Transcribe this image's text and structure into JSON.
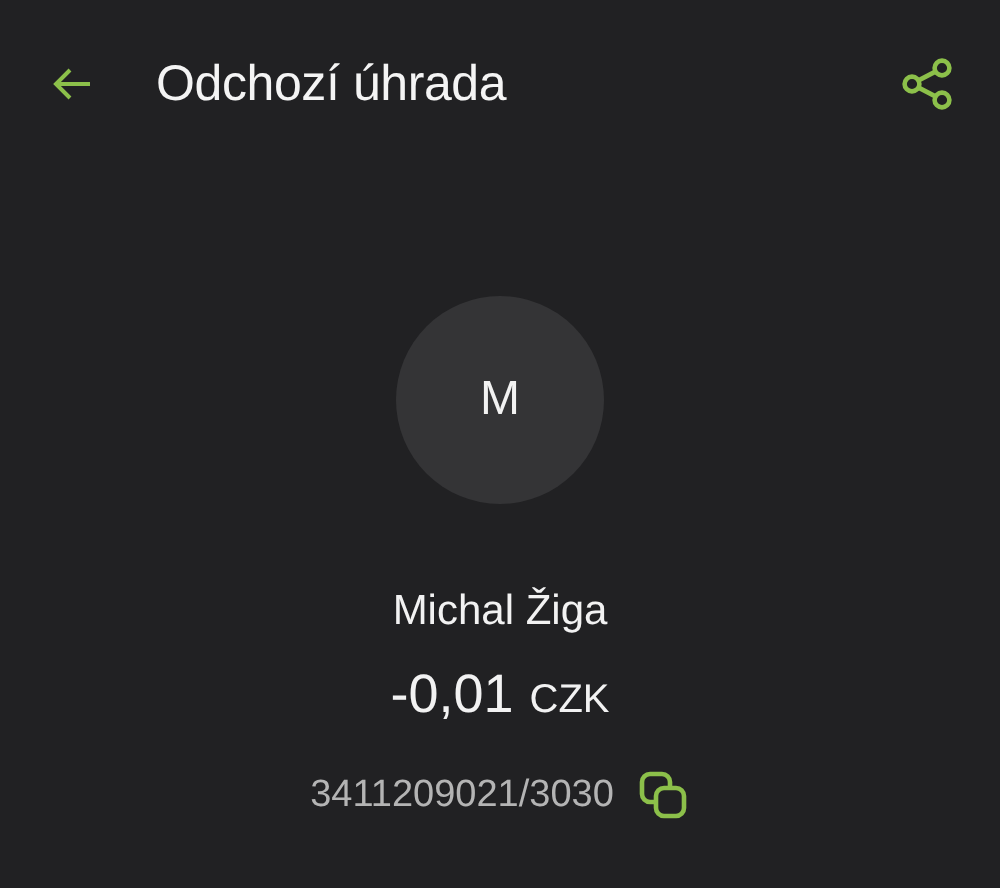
{
  "header": {
    "title": "Odchozí úhrada"
  },
  "counterparty": {
    "initial": "M",
    "name": "Michal Žiga",
    "amount": "-0,01",
    "currency": "CZK",
    "account": "3411209021/3030"
  }
}
